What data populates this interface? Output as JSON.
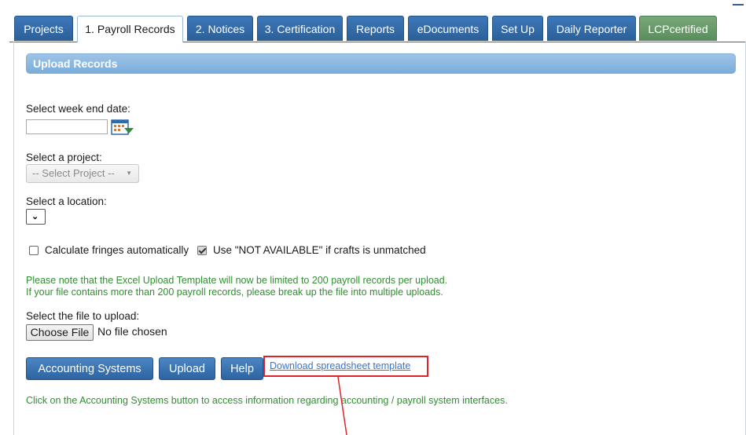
{
  "tabs": [
    {
      "label": "Projects"
    },
    {
      "label": "1. Payroll Records"
    },
    {
      "label": "2. Notices"
    },
    {
      "label": "3. Certification"
    },
    {
      "label": "Reports"
    },
    {
      "label": "eDocuments"
    },
    {
      "label": "Set Up"
    },
    {
      "label": "Daily Reporter"
    },
    {
      "label": "LCPcertified"
    }
  ],
  "section": {
    "title": "Upload Records"
  },
  "week_end": {
    "label": "Select week end date:",
    "value": ""
  },
  "project": {
    "label": "Select a project:",
    "selected": "-- Select Project --"
  },
  "location": {
    "label": "Select a location:",
    "selected": ""
  },
  "options": {
    "calc_fringes": {
      "label": "Calculate fringes automatically",
      "checked": false
    },
    "not_available": {
      "label": "Use \"NOT AVAILABLE\" if crafts is unmatched",
      "checked": true
    }
  },
  "notice": {
    "line1": "Please note that the Excel Upload Template will now be limited to 200 payroll records per upload.",
    "line2": "If your file contains more than 200 payroll records, please break up the file into multiple uploads."
  },
  "file": {
    "label": "Select the file to upload:",
    "button": "Choose File",
    "status": "No file chosen"
  },
  "actions": {
    "accounting": "Accounting Systems",
    "upload": "Upload",
    "help": "Help",
    "download": "Download spreadsheet template"
  },
  "footer_note": "Click on the Accounting Systems button to access information regarding accounting / payroll system interfaces.",
  "colors": {
    "tab_blue": "#2f6ba8",
    "tab_green": "#5a8c5d",
    "notice_green": "#2f8f2f",
    "highlight_red": "#e0232b"
  }
}
